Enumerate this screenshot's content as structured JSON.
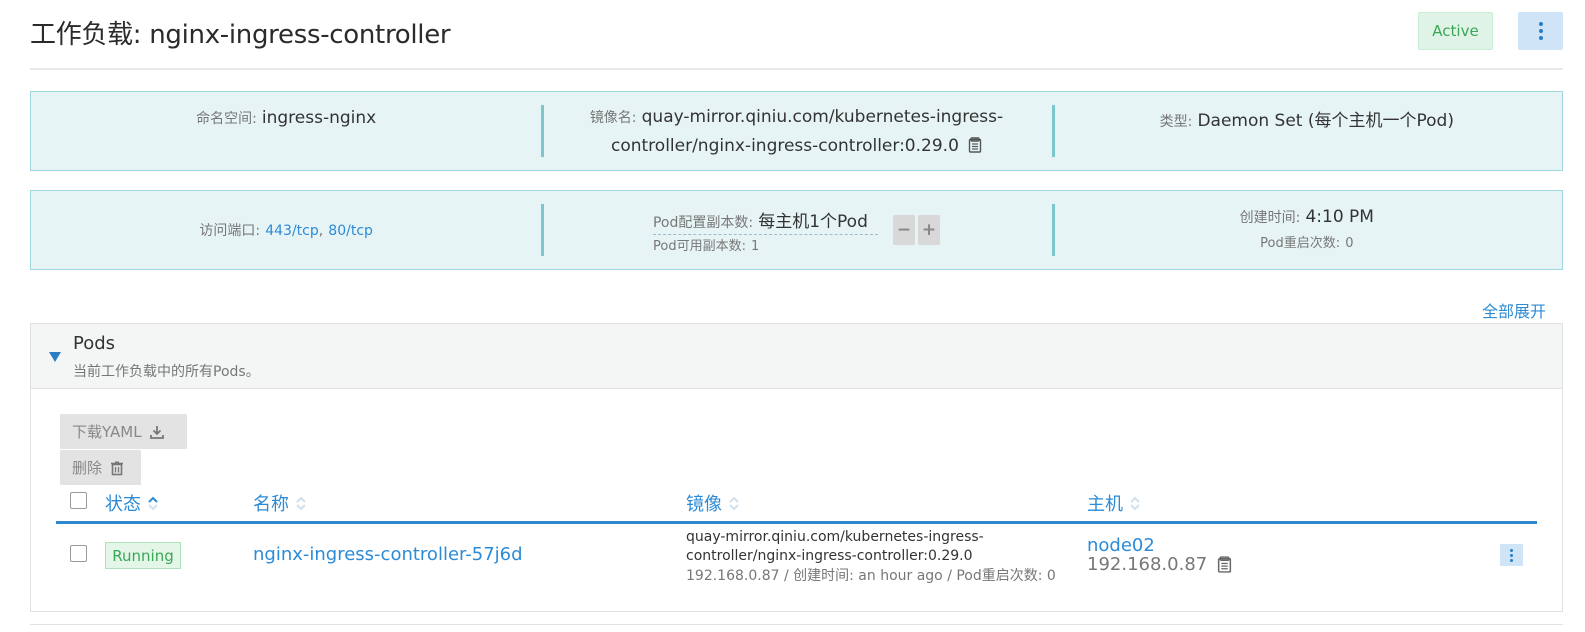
{
  "header": {
    "title": "工作负载: nginx-ingress-controller",
    "status": "Active"
  },
  "info_row1": {
    "namespace_label": "命名空间:",
    "namespace_value": "ingress-nginx",
    "image_label": "镜像名:",
    "image_value_line1": "quay-mirror.qiniu.com/kubernetes-ingress-",
    "image_value_line2": "controller/nginx-ingress-controller:0.29.0",
    "type_label": "类型:",
    "type_value": "Daemon Set (每个主机一个Pod)"
  },
  "info_row2": {
    "ports_label": "访问端口:",
    "ports": [
      "443/tcp",
      "80/tcp"
    ],
    "ports_sep": ",",
    "replica_label": "Pod配置副本数:",
    "replica_value": "每主机1个Pod",
    "available_label": "Pod可用副本数:",
    "available_value": "1",
    "minus": "−",
    "plus": "+",
    "created_label": "创建时间:",
    "created_value": "4:10 PM",
    "restart_label": "Pod重启次数:",
    "restart_value": "0"
  },
  "expand_all": "全部展开",
  "pods": {
    "title": "Pods",
    "description": "当前工作负载中的所有Pods。",
    "download_yaml": "下载YAML",
    "delete": "删除",
    "columns": {
      "status": "状态",
      "name": "名称",
      "image": "镜像",
      "node": "主机"
    },
    "rows": [
      {
        "status": "Running",
        "name": "nginx-ingress-controller-57j6d",
        "image_line1": "quay-mirror.qiniu.com/kubernetes-ingress-",
        "image_line2": "controller/nginx-ingress-controller:0.29.0",
        "meta": "192.168.0.87 / 创建时间: an hour ago / Pod重启次数: 0",
        "node": "node02",
        "node_ip": "192.168.0.87"
      }
    ]
  },
  "colors": {
    "accent": "#2d8bd6",
    "active_bg": "#dff3e6",
    "active_text": "#3aa757",
    "info_bg": "#e7f4f6",
    "info_border": "#9fd7dd"
  }
}
